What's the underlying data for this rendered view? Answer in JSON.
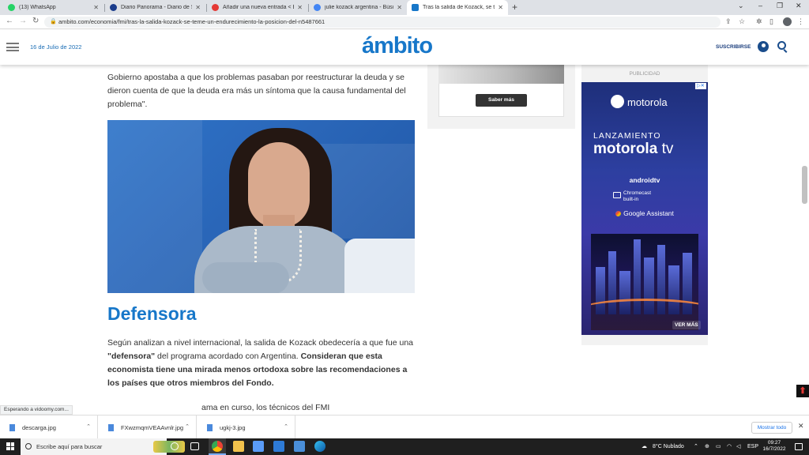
{
  "browser": {
    "tabs": [
      {
        "title": "(13) WhatsApp",
        "active": false,
        "color": "#25d366"
      },
      {
        "title": "Diario Panorama - Diario de Sant",
        "active": false,
        "color": "#1a3c8c"
      },
      {
        "title": "Añadir una nueva entrada < Esc",
        "active": false,
        "color": "#e53935"
      },
      {
        "title": "julie kozack argentina - Búsqued",
        "active": false,
        "color": "#4285f4"
      },
      {
        "title": "Tras la salida de Kozack, se teme",
        "active": true,
        "color": "#1777c9"
      }
    ],
    "new_tab_symbol": "+",
    "window_controls": {
      "dropdown": "⌄",
      "minimize": "–",
      "restore": "❐",
      "close": "✕"
    },
    "address": "ambito.com/economia/fmi/tras-la-salida-kozack-se-teme-un-endurecimiento-la-posicion-del-n5487661",
    "nav": {
      "back": "←",
      "forward": "→",
      "reload": "↻"
    }
  },
  "site": {
    "date": "16 de Julio de 2022",
    "logo": "ámbito",
    "subscribe": "SUSCRIBIRSE",
    "brand_color": "#1777c9"
  },
  "article": {
    "paragraph_top": "Gobierno apostaba a que los problemas pasaban por reestructurar la deuda y se dieron cuenta de que la deuda era más un síntoma que la causa fundamental del problema\".",
    "heading": "Defensora",
    "paragraph_main_1": "Según analizan a nivel internacional, la salida de Kozack obedecería a que fue una ",
    "paragraph_main_bold_1": "\"defensora\"",
    "paragraph_main_2": " del programa acordado con Argentina. ",
    "paragraph_main_bold_2": "Consideran que esta economista tiene una mirada menos ortodoxa sobre las recomendaciones a los países que otros miembros del Fondo.",
    "paragraph_cut": "ama en curso, los técnicos del FMI"
  },
  "ads": {
    "top_button": "Saber más",
    "publicidad": "PUBLICIDAD",
    "moto": {
      "brand": "motorola",
      "launch": "LANZAMIENTO",
      "product": "motorola",
      "product_tv": "tv",
      "androidtv": "androidtv",
      "chromecast_1": "Chromecast",
      "chromecast_2": "built-in",
      "assistant": "Google Assistant",
      "ver_mas": "VER MÁS"
    }
  },
  "status_text": "Esperando a vidoomy.com...",
  "downloads": [
    {
      "name": "descarga.jpg"
    },
    {
      "name": "FXwzmqmVEAAvnlr.jpg"
    },
    {
      "name": "ugkj-3.jpg"
    }
  ],
  "downloads_show_all": "Mostrar todo",
  "taskbar": {
    "search_placeholder": "Escribe aquí para buscar",
    "weather": "8°C  Nublado",
    "language": "ESP",
    "time": "09:27",
    "date": "16/7/2022"
  }
}
